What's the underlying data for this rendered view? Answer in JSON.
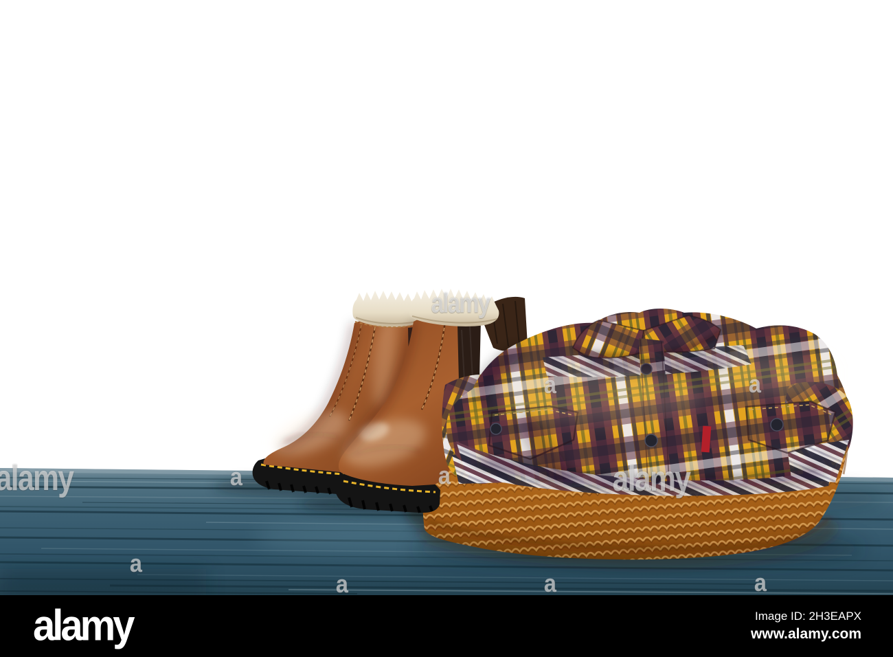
{
  "image": {
    "alt": "Pair of brown fur-lined leather chelsea boots, folded yellow plaid flannel shirt and orange knitted sweater on a blue wooden table against white background"
  },
  "watermark": {
    "brand": "alamy",
    "letter": "a"
  },
  "footer": {
    "logo": "alamy",
    "image_id": "Image ID: 2H3EAPX",
    "website": "www.alamy.com"
  },
  "colors": {
    "background": "#ffffff",
    "footer_bg": "#000000",
    "table_blue": "#3a5d70",
    "table_dark": "#24434f",
    "boot_leather": "#96502a",
    "boot_leather_dark": "#6e3413",
    "boot_gusset": "#33231c",
    "boot_sole": "#141414",
    "sole_stitch": "#e8b42a",
    "fur": "#ece4d0",
    "sweater_orange": "#b66a1c",
    "shirt_gold": "#e3a41f",
    "shirt_maroon": "#5e3040",
    "shirt_navy": "#262334",
    "shirt_olive": "#6e6a26",
    "shirt_white": "#ecebee",
    "tag_red": "#b3202a",
    "button_navy": "#23242e"
  }
}
